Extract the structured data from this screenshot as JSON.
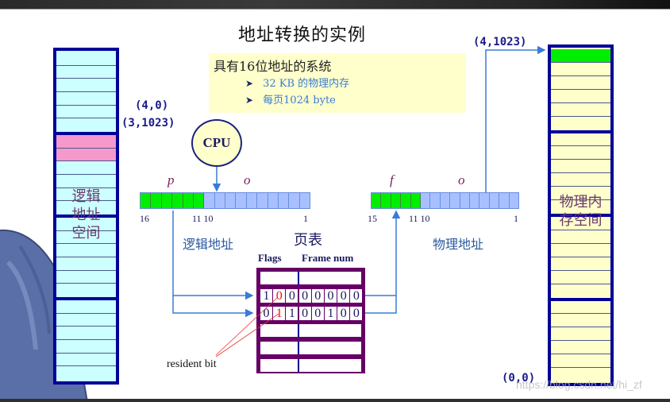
{
  "title": "地址转换的实例",
  "info": {
    "heading": "具有16位地址的系统",
    "items": [
      "32 KB 的物理内存",
      "每页1024 byte"
    ],
    "bullet": "➤"
  },
  "logical_space": {
    "label_lines": [
      "逻辑",
      "地址",
      "空间"
    ],
    "addr_top": "(4,0)",
    "addr_bottom": "(3,1023)",
    "row_color": "#ccffff",
    "highlight_color": "#f598cc",
    "highlighted_rows": [
      6,
      7
    ]
  },
  "physical_space": {
    "label_lines": [
      "物理内",
      "存空间"
    ],
    "addr_top": "(4,1023)",
    "addr_bottom": "(0,0)",
    "row_color": "#ffffcc",
    "highlight_color": "#00ee00",
    "highlighted_rows": [
      0
    ]
  },
  "cpu": {
    "label": "CPU"
  },
  "logical_address": {
    "label": "逻辑地址",
    "page_field": "p",
    "offset_field": "o",
    "bits_total": 16,
    "page_bits": 6,
    "tick_labels": {
      "high": "16",
      "split": "11 10",
      "low": "1"
    }
  },
  "physical_address": {
    "label": "物理地址",
    "frame_field": "f",
    "offset_field": "o",
    "bits_total": 15,
    "frame_bits": 5,
    "tick_labels": {
      "high": "15",
      "split": "11 10",
      "low": "1"
    }
  },
  "page_table": {
    "title": "页表",
    "col_flags": "Flags",
    "col_frame": "Frame num",
    "rows": [
      {
        "bits": []
      },
      {
        "bits": [
          "1",
          "0",
          "0",
          "0",
          "0",
          "0",
          "0",
          "0"
        ],
        "red": [
          1
        ]
      },
      {
        "bits": [
          "0",
          "1",
          "1",
          "0",
          "0",
          "1",
          "0",
          "0"
        ],
        "red": [
          1
        ]
      },
      {
        "bits": []
      },
      {
        "bits": []
      },
      {
        "bits": []
      }
    ]
  },
  "annotation": {
    "resident_bit": "resident bit"
  },
  "watermark": "https://blog.csdn.net/hi_zf"
}
